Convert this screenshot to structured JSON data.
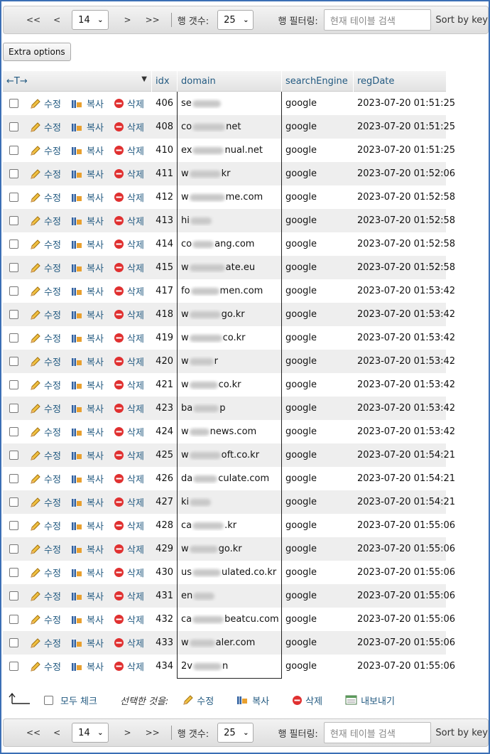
{
  "navigation": {
    "first": "<<",
    "prev": "<",
    "page": "14",
    "next": ">",
    "last": ">>",
    "rows_label": "행 갯수:",
    "rows_value": "25",
    "filter_label": "행 필터링:",
    "filter_placeholder": "현재 테이블 검색",
    "sort_label": "Sort by key"
  },
  "extra_options": "Extra options",
  "table": {
    "headers": {
      "arrows": "←T→",
      "idx": "idx",
      "domain": "domain",
      "searchEngine": "searchEngine",
      "regDate": "regDate"
    },
    "actions": {
      "edit": "수정",
      "copy": "복사",
      "delete": "삭제"
    },
    "rows": [
      {
        "idx": "406",
        "d_pre": "se",
        "d_post": "",
        "se": "google",
        "date": "2023-07-20 01:51:25"
      },
      {
        "idx": "408",
        "d_pre": "co",
        "d_post": "net",
        "se": "google",
        "date": "2023-07-20 01:51:25"
      },
      {
        "idx": "410",
        "d_pre": "ex",
        "d_post": "nual.net",
        "se": "google",
        "date": "2023-07-20 01:51:25"
      },
      {
        "idx": "411",
        "d_pre": "w",
        "d_post": "kr",
        "se": "google",
        "date": "2023-07-20 01:52:06"
      },
      {
        "idx": "412",
        "d_pre": "w",
        "d_post": "me.com",
        "se": "google",
        "date": "2023-07-20 01:52:58"
      },
      {
        "idx": "413",
        "d_pre": "hi",
        "d_post": "",
        "se": "google",
        "date": "2023-07-20 01:52:58"
      },
      {
        "idx": "414",
        "d_pre": "co",
        "d_post": "ang.com",
        "se": "google",
        "date": "2023-07-20 01:52:58"
      },
      {
        "idx": "415",
        "d_pre": "w",
        "d_post": "ate.eu",
        "se": "google",
        "date": "2023-07-20 01:52:58"
      },
      {
        "idx": "417",
        "d_pre": "fo",
        "d_post": "men.com",
        "se": "google",
        "date": "2023-07-20 01:53:42"
      },
      {
        "idx": "418",
        "d_pre": "w",
        "d_post": "go.kr",
        "se": "google",
        "date": "2023-07-20 01:53:42"
      },
      {
        "idx": "419",
        "d_pre": "w",
        "d_post": "co.kr",
        "se": "google",
        "date": "2023-07-20 01:53:42"
      },
      {
        "idx": "420",
        "d_pre": "w",
        "d_post": "r",
        "se": "google",
        "date": "2023-07-20 01:53:42"
      },
      {
        "idx": "421",
        "d_pre": "w",
        "d_post": "co.kr",
        "se": "google",
        "date": "2023-07-20 01:53:42"
      },
      {
        "idx": "423",
        "d_pre": "ba",
        "d_post": "p",
        "se": "google",
        "date": "2023-07-20 01:53:42"
      },
      {
        "idx": "424",
        "d_pre": "w",
        "d_post": "news.com",
        "se": "google",
        "date": "2023-07-20 01:53:42"
      },
      {
        "idx": "425",
        "d_pre": "w",
        "d_post": "oft.co.kr",
        "se": "google",
        "date": "2023-07-20 01:54:21"
      },
      {
        "idx": "426",
        "d_pre": "da",
        "d_post": "culate.com",
        "se": "google",
        "date": "2023-07-20 01:54:21"
      },
      {
        "idx": "427",
        "d_pre": "ki",
        "d_post": "",
        "se": "google",
        "date": "2023-07-20 01:54:21"
      },
      {
        "idx": "428",
        "d_pre": "ca",
        "d_post": ".kr",
        "se": "google",
        "date": "2023-07-20 01:55:06"
      },
      {
        "idx": "429",
        "d_pre": "w",
        "d_post": "go.kr",
        "se": "google",
        "date": "2023-07-20 01:55:06"
      },
      {
        "idx": "430",
        "d_pre": "us",
        "d_post": "ulated.co.kr",
        "se": "google",
        "date": "2023-07-20 01:55:06"
      },
      {
        "idx": "431",
        "d_pre": "en",
        "d_post": "",
        "se": "google",
        "date": "2023-07-20 01:55:06"
      },
      {
        "idx": "432",
        "d_pre": "ca",
        "d_post": "beatcu.com",
        "se": "google",
        "date": "2023-07-20 01:55:06"
      },
      {
        "idx": "433",
        "d_pre": "w",
        "d_post": "aler.com",
        "se": "google",
        "date": "2023-07-20 01:55:06"
      },
      {
        "idx": "434",
        "d_pre": "2v",
        "d_post": "n",
        "se": "google",
        "date": "2023-07-20 01:55:06"
      }
    ]
  },
  "bulk": {
    "check_all": "모두 체크",
    "with_selected": "선택한 것을:",
    "edit": "수정",
    "copy": "복사",
    "delete": "삭제",
    "export": "내보내기"
  },
  "colors": {
    "link": "#235a81",
    "border": "#3b6fb5"
  },
  "icons": [
    "pencil-icon",
    "copy-icon",
    "delete-icon",
    "export-icon",
    "select-arrow-icon"
  ]
}
